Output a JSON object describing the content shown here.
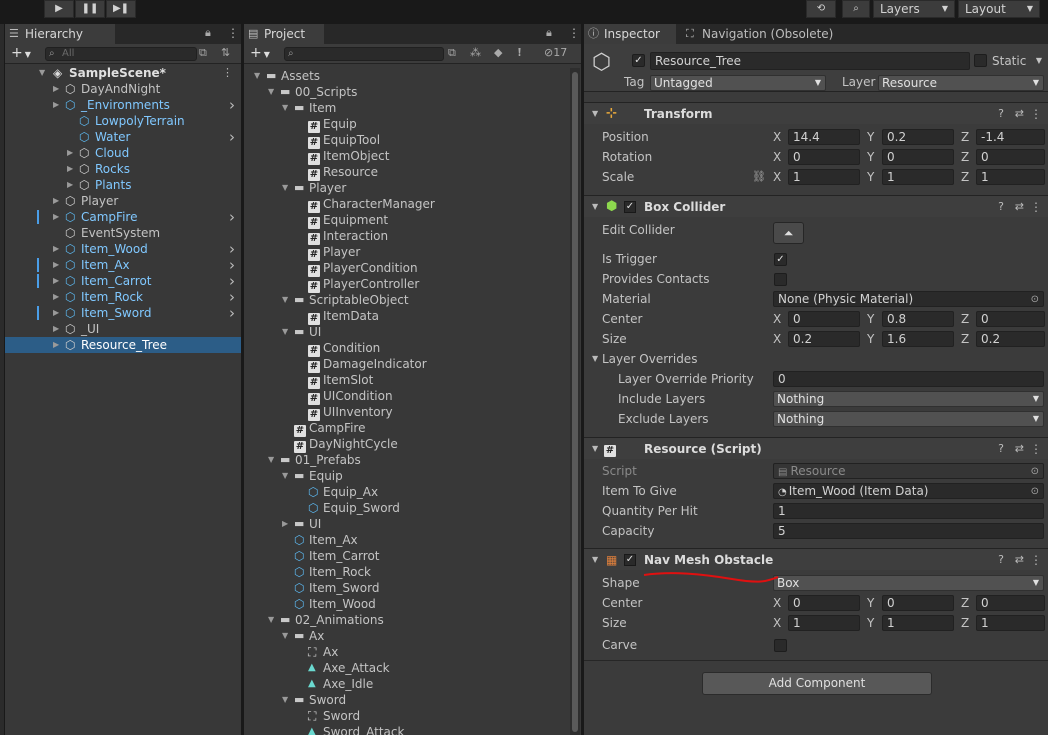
{
  "toolbar": {
    "play_icon": "▶",
    "pause_icon": "❚❚",
    "step_icon": "▶❚",
    "history_icon": "⟲",
    "search_icon": "⌕",
    "layers_label": "Layers",
    "layout_label": "Layout"
  },
  "hierarchy": {
    "tab_label": "Hierarchy",
    "search_placeholder": "All",
    "scene_name": "SampleScene*",
    "items": [
      {
        "label": "DayAndNight",
        "indent": 1,
        "arrow": true,
        "icon": "cube",
        "prefab": false,
        "chevron": false,
        "mark": false
      },
      {
        "label": "_Environments",
        "indent": 1,
        "arrow": true,
        "icon": "cube-blue",
        "prefab": true,
        "chevron": true,
        "mark": false,
        "expanded": true
      },
      {
        "label": "LowpolyTerrain",
        "indent": 2,
        "arrow": false,
        "icon": "cube-blue",
        "prefab": true,
        "chevron": false,
        "mark": false
      },
      {
        "label": "Water",
        "indent": 2,
        "arrow": false,
        "icon": "cube-blue",
        "prefab": true,
        "chevron": true,
        "mark": false
      },
      {
        "label": "Cloud",
        "indent": 2,
        "arrow": true,
        "icon": "cube",
        "prefab": true,
        "chevron": false,
        "mark": false
      },
      {
        "label": "Rocks",
        "indent": 2,
        "arrow": true,
        "icon": "cube",
        "prefab": true,
        "chevron": false,
        "mark": false
      },
      {
        "label": "Plants",
        "indent": 2,
        "arrow": true,
        "icon": "cube",
        "prefab": true,
        "chevron": false,
        "mark": false
      },
      {
        "label": "Player",
        "indent": 1,
        "arrow": true,
        "icon": "cube",
        "prefab": false,
        "chevron": false,
        "mark": false
      },
      {
        "label": "CampFire",
        "indent": 1,
        "arrow": true,
        "icon": "cube-blue",
        "prefab": true,
        "chevron": true,
        "mark": true
      },
      {
        "label": "EventSystem",
        "indent": 1,
        "arrow": false,
        "icon": "cube",
        "prefab": false,
        "chevron": false,
        "mark": false
      },
      {
        "label": "Item_Wood",
        "indent": 1,
        "arrow": true,
        "icon": "cube-blue",
        "prefab": true,
        "chevron": true,
        "mark": false
      },
      {
        "label": "Item_Ax",
        "indent": 1,
        "arrow": true,
        "icon": "cube-blue",
        "prefab": true,
        "chevron": true,
        "mark": true
      },
      {
        "label": "Item_Carrot",
        "indent": 1,
        "arrow": true,
        "icon": "cube-blue",
        "prefab": true,
        "chevron": true,
        "mark": true
      },
      {
        "label": "Item_Rock",
        "indent": 1,
        "arrow": true,
        "icon": "cube-blue",
        "prefab": true,
        "chevron": true,
        "mark": false
      },
      {
        "label": "Item_Sword",
        "indent": 1,
        "arrow": true,
        "icon": "cube-blue",
        "prefab": true,
        "chevron": true,
        "mark": true
      },
      {
        "label": "_UI",
        "indent": 1,
        "arrow": true,
        "icon": "cube",
        "prefab": false,
        "chevron": false,
        "mark": false
      },
      {
        "label": "Resource_Tree",
        "indent": 1,
        "arrow": true,
        "icon": "cube",
        "prefab": false,
        "chevron": false,
        "mark": false,
        "selected": true
      }
    ]
  },
  "project": {
    "tab_label": "Project",
    "hidden_count": "17",
    "items": [
      {
        "label": "Assets",
        "indent": 0,
        "arrow": "down",
        "icon": "folder"
      },
      {
        "label": "00_Scripts",
        "indent": 1,
        "arrow": "down",
        "icon": "folder"
      },
      {
        "label": "Item",
        "indent": 2,
        "arrow": "down",
        "icon": "folder"
      },
      {
        "label": "Equip",
        "indent": 3,
        "arrow": "",
        "icon": "script"
      },
      {
        "label": "EquipTool",
        "indent": 3,
        "arrow": "",
        "icon": "script"
      },
      {
        "label": "ItemObject",
        "indent": 3,
        "arrow": "",
        "icon": "script"
      },
      {
        "label": "Resource",
        "indent": 3,
        "arrow": "",
        "icon": "script"
      },
      {
        "label": "Player",
        "indent": 2,
        "arrow": "down",
        "icon": "folder"
      },
      {
        "label": "CharacterManager",
        "indent": 3,
        "arrow": "",
        "icon": "script"
      },
      {
        "label": "Equipment",
        "indent": 3,
        "arrow": "",
        "icon": "script"
      },
      {
        "label": "Interaction",
        "indent": 3,
        "arrow": "",
        "icon": "script"
      },
      {
        "label": "Player",
        "indent": 3,
        "arrow": "",
        "icon": "script"
      },
      {
        "label": "PlayerCondition",
        "indent": 3,
        "arrow": "",
        "icon": "script"
      },
      {
        "label": "PlayerController",
        "indent": 3,
        "arrow": "",
        "icon": "script"
      },
      {
        "label": "ScriptableObject",
        "indent": 2,
        "arrow": "down",
        "icon": "folder"
      },
      {
        "label": "ItemData",
        "indent": 3,
        "arrow": "",
        "icon": "script"
      },
      {
        "label": "UI",
        "indent": 2,
        "arrow": "down",
        "icon": "folder"
      },
      {
        "label": "Condition",
        "indent": 3,
        "arrow": "",
        "icon": "script"
      },
      {
        "label": "DamageIndicator",
        "indent": 3,
        "arrow": "",
        "icon": "script"
      },
      {
        "label": "ItemSlot",
        "indent": 3,
        "arrow": "",
        "icon": "script"
      },
      {
        "label": "UICondition",
        "indent": 3,
        "arrow": "",
        "icon": "script"
      },
      {
        "label": "UIInventory",
        "indent": 3,
        "arrow": "",
        "icon": "script"
      },
      {
        "label": "CampFire",
        "indent": 2,
        "arrow": "",
        "icon": "script"
      },
      {
        "label": "DayNightCycle",
        "indent": 2,
        "arrow": "",
        "icon": "script"
      },
      {
        "label": "01_Prefabs",
        "indent": 1,
        "arrow": "down",
        "icon": "folder"
      },
      {
        "label": "Equip",
        "indent": 2,
        "arrow": "down",
        "icon": "folder"
      },
      {
        "label": "Equip_Ax",
        "indent": 3,
        "arrow": "",
        "icon": "prefab"
      },
      {
        "label": "Equip_Sword",
        "indent": 3,
        "arrow": "",
        "icon": "prefab"
      },
      {
        "label": "UI",
        "indent": 2,
        "arrow": "right",
        "icon": "folder"
      },
      {
        "label": "Item_Ax",
        "indent": 2,
        "arrow": "",
        "icon": "prefab"
      },
      {
        "label": "Item_Carrot",
        "indent": 2,
        "arrow": "",
        "icon": "prefab"
      },
      {
        "label": "Item_Rock",
        "indent": 2,
        "arrow": "",
        "icon": "prefab"
      },
      {
        "label": "Item_Sword",
        "indent": 2,
        "arrow": "",
        "icon": "prefab"
      },
      {
        "label": "Item_Wood",
        "indent": 2,
        "arrow": "",
        "icon": "prefab"
      },
      {
        "label": "02_Animations",
        "indent": 1,
        "arrow": "down",
        "icon": "folder"
      },
      {
        "label": "Ax",
        "indent": 2,
        "arrow": "down",
        "icon": "folder"
      },
      {
        "label": "Ax",
        "indent": 3,
        "arrow": "",
        "icon": "animator"
      },
      {
        "label": "Axe_Attack",
        "indent": 3,
        "arrow": "",
        "icon": "anim"
      },
      {
        "label": "Axe_Idle",
        "indent": 3,
        "arrow": "",
        "icon": "anim"
      },
      {
        "label": "Sword",
        "indent": 2,
        "arrow": "down",
        "icon": "folder"
      },
      {
        "label": "Sword",
        "indent": 3,
        "arrow": "",
        "icon": "animator"
      },
      {
        "label": "Sword_Attack",
        "indent": 3,
        "arrow": "",
        "icon": "anim"
      }
    ]
  },
  "inspector": {
    "tab_label": "Inspector",
    "tab2_label": "Navigation (Obsolete)",
    "object_name": "Resource_Tree",
    "static_label": "Static",
    "tag_label": "Tag",
    "tag_value": "Untagged",
    "layer_label": "Layer",
    "layer_value": "Resource",
    "add_component": "Add Component",
    "transform": {
      "title": "Transform",
      "position_label": "Position",
      "position": [
        "14.4",
        "0.2",
        "-1.4"
      ],
      "rotation_label": "Rotation",
      "rotation": [
        "0",
        "0",
        "0"
      ],
      "scale_label": "Scale",
      "scale": [
        "1",
        "1",
        "1"
      ]
    },
    "box_collider": {
      "title": "Box Collider",
      "edit_collider_label": "Edit Collider",
      "is_trigger_label": "Is Trigger",
      "is_trigger": true,
      "provides_contacts_label": "Provides Contacts",
      "provides_contacts": false,
      "material_label": "Material",
      "material": "None (Physic Material)",
      "center_label": "Center",
      "center": [
        "0",
        "0.8",
        "0"
      ],
      "size_label": "Size",
      "size": [
        "0.2",
        "1.6",
        "0.2"
      ],
      "layer_overrides_label": "Layer Overrides",
      "priority_label": "Layer Override Priority",
      "priority": "0",
      "include_label": "Include Layers",
      "include": "Nothing",
      "exclude_label": "Exclude Layers",
      "exclude": "Nothing"
    },
    "resource_script": {
      "title": "Resource (Script)",
      "script_label": "Script",
      "script": "Resource",
      "item_label": "Item To Give",
      "item": "Item_Wood (Item Data)",
      "qty_label": "Quantity Per Hit",
      "qty": "1",
      "capacity_label": "Capacity",
      "capacity": "5"
    },
    "nav_mesh_obstacle": {
      "title": "Nav Mesh Obstacle",
      "shape_label": "Shape",
      "shape": "Box",
      "center_label": "Center",
      "center": [
        "0",
        "0",
        "0"
      ],
      "size_label": "Size",
      "size": [
        "1",
        "1",
        "1"
      ],
      "carve_label": "Carve",
      "carve": false
    },
    "axis_labels": [
      "X",
      "Y",
      "Z"
    ]
  },
  "colors": {
    "selection": "#2c5d87",
    "prefab_blue": "#80c8ff",
    "annotation_red": "#e01010"
  }
}
